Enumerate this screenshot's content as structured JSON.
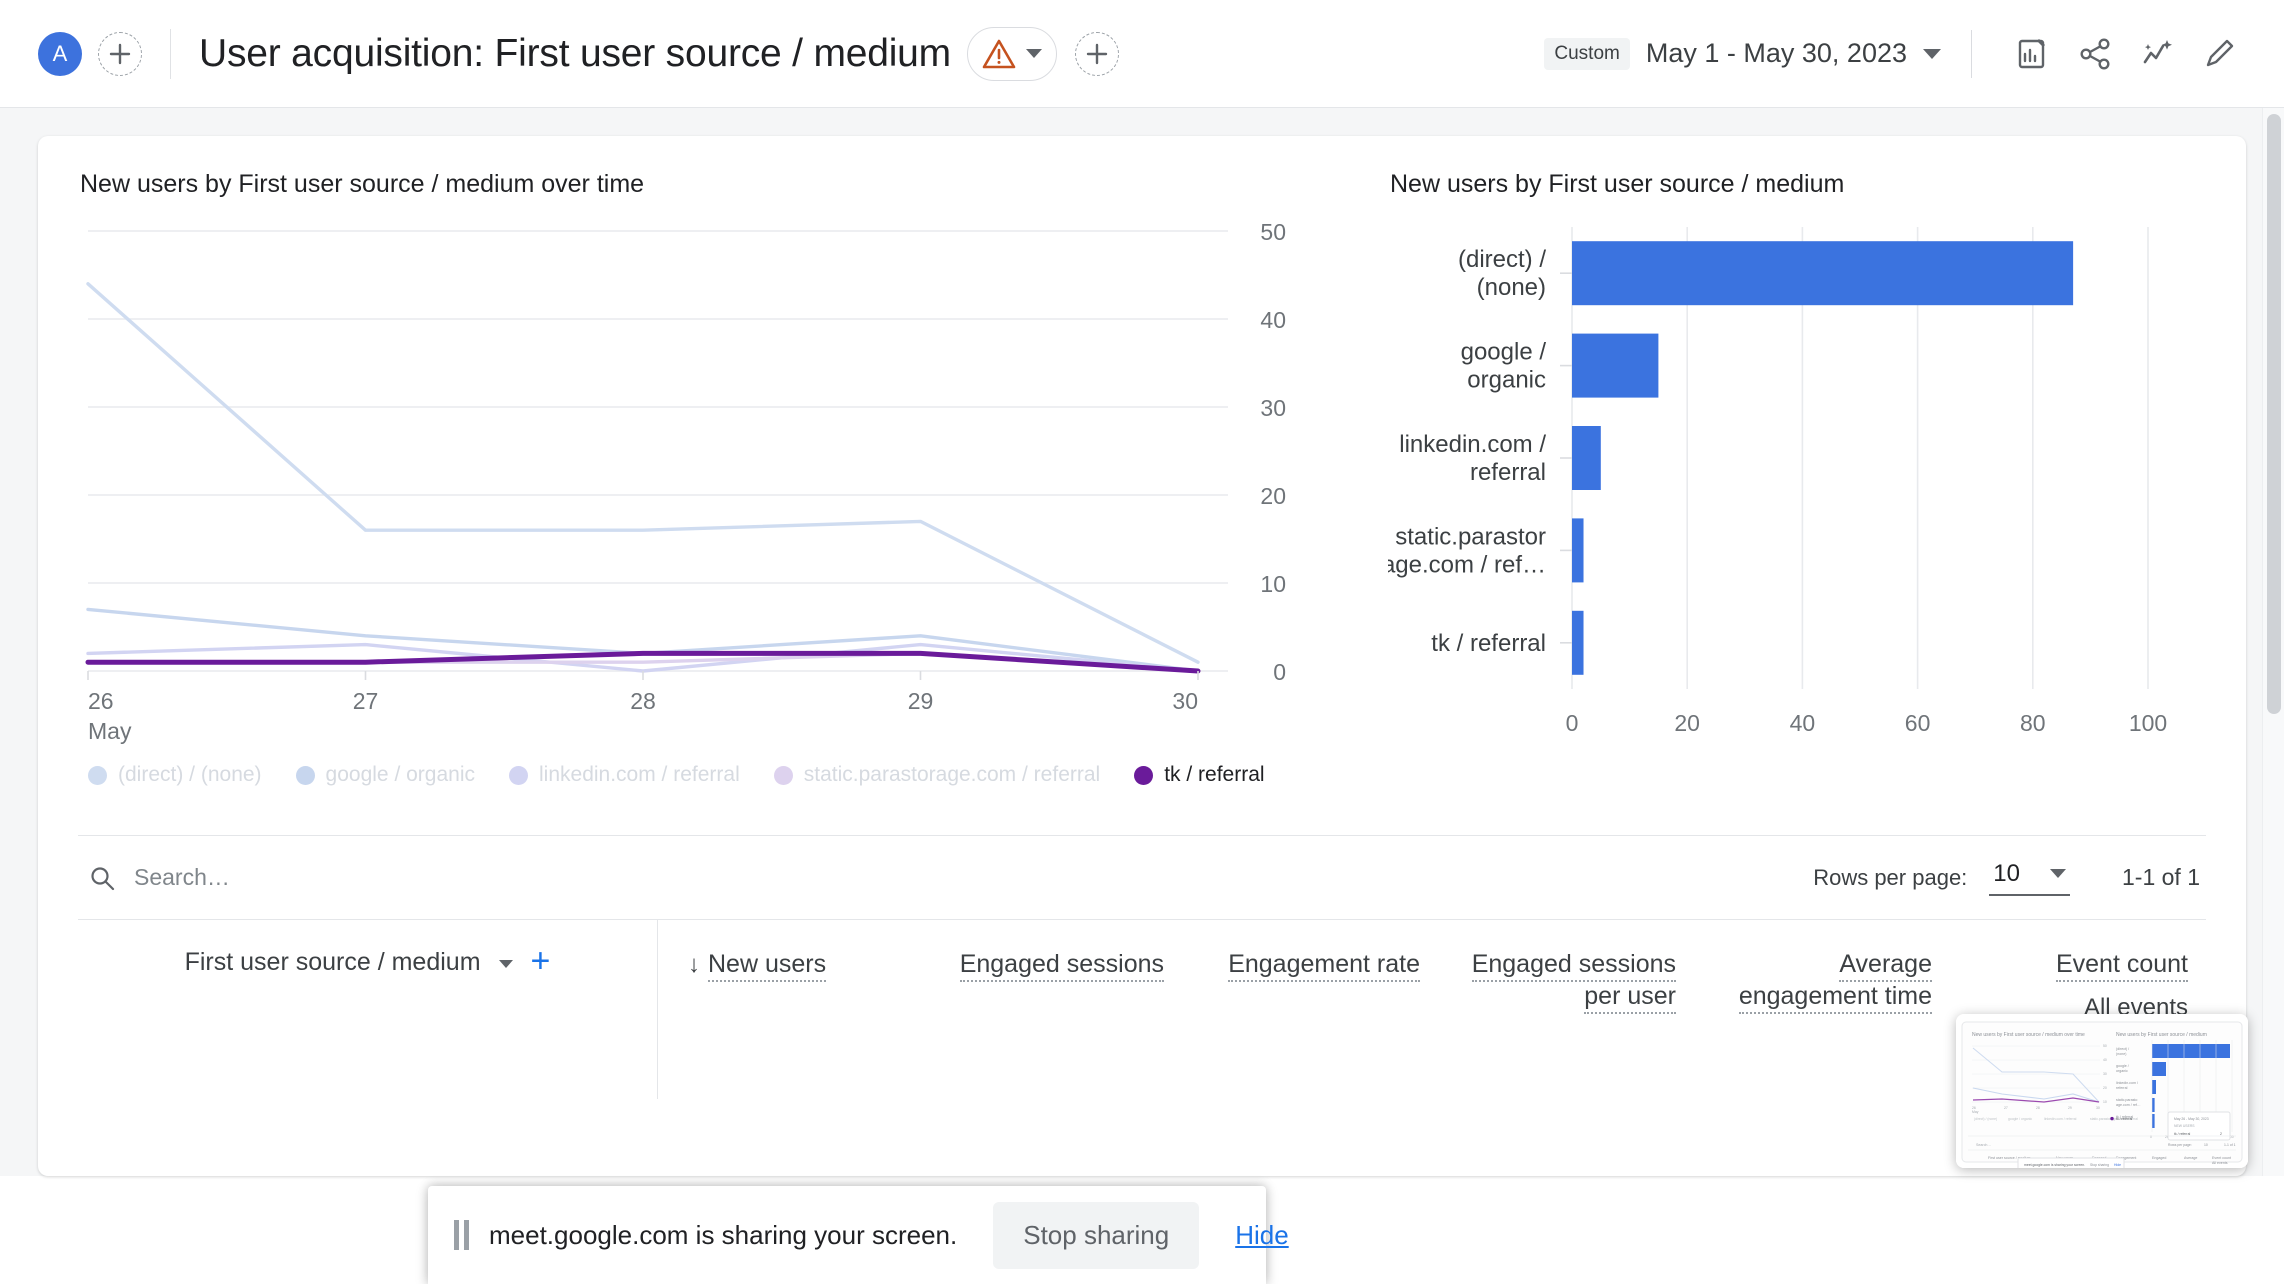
{
  "header": {
    "avatar_initial": "A",
    "title": "User acquisition: First user source / medium",
    "warning_icon": "warning-triangle-icon",
    "add_icon": "plus-icon",
    "date_chip": "Custom",
    "date_range": "May 1 - May 30, 2023",
    "icons": [
      {
        "name": "edit-report-icon"
      },
      {
        "name": "share-icon"
      },
      {
        "name": "insights-icon"
      },
      {
        "name": "pencil-edit-icon"
      }
    ]
  },
  "chart_data": [
    {
      "type": "line",
      "title": "New users by First user source / medium over time",
      "xlabel": "",
      "ylabel": "",
      "x": [
        "26",
        "27",
        "28",
        "29",
        "30"
      ],
      "x_axis_caption": "May",
      "ylim": [
        0,
        50
      ],
      "yticks": [
        0,
        10,
        20,
        30,
        40,
        50
      ],
      "grid": true,
      "legend_position": "bottom",
      "series": [
        {
          "name": "(direct) / (none)",
          "color": "#cfdcf0",
          "values": [
            44,
            16,
            16,
            17,
            1
          ]
        },
        {
          "name": "google / organic",
          "color": "#c7d6ee",
          "values": [
            7,
            4,
            2,
            4,
            0
          ]
        },
        {
          "name": "linkedin.com / referral",
          "color": "#d2d4f2",
          "values": [
            2,
            3,
            0,
            3,
            0
          ]
        },
        {
          "name": "static.parastorage.com / referral",
          "color": "#ddd2ee",
          "values": [
            1,
            1,
            1,
            2,
            0
          ]
        },
        {
          "name": "tk / referral",
          "color": "#6a1b9a",
          "values": [
            1,
            1,
            2,
            2,
            0
          ]
        }
      ]
    },
    {
      "type": "bar",
      "orientation": "horizontal",
      "title": "New users by First user source / medium",
      "categories": [
        "(direct) / (none)",
        "google / organic",
        "linkedin.com / referral",
        "static.parastorage.com / ref…",
        "tk / referral"
      ],
      "values": [
        87,
        15,
        5,
        2,
        2
      ],
      "xlim": [
        0,
        100
      ],
      "xticks": [
        0,
        20,
        40,
        60,
        80,
        100
      ],
      "bar_color": "#3b73df",
      "grid": true
    }
  ],
  "table_tools": {
    "search_placeholder": "Search…",
    "search_value": "",
    "search_icon": "search-icon",
    "rows_per_page_label": "Rows per page:",
    "rows_per_page_value": "10",
    "range_text": "1-1 of 1"
  },
  "table": {
    "dimension_label": "First user source / medium",
    "add_dimension_icon": "plus-icon",
    "columns": [
      {
        "label": "New users",
        "sorted": true,
        "sort_icon": "arrow-down-icon"
      },
      {
        "label": "Engaged sessions"
      },
      {
        "label": "Engagement rate"
      },
      {
        "label": "Engaged sessions per user"
      },
      {
        "label": "Average engagement time"
      },
      {
        "label": "Event count",
        "sub": "All events"
      }
    ]
  },
  "share_notification": {
    "message": "meet.google.com is sharing your screen.",
    "stop_label": "Stop sharing",
    "hide_label": "Hide",
    "pause_icon": "pause-icon"
  }
}
